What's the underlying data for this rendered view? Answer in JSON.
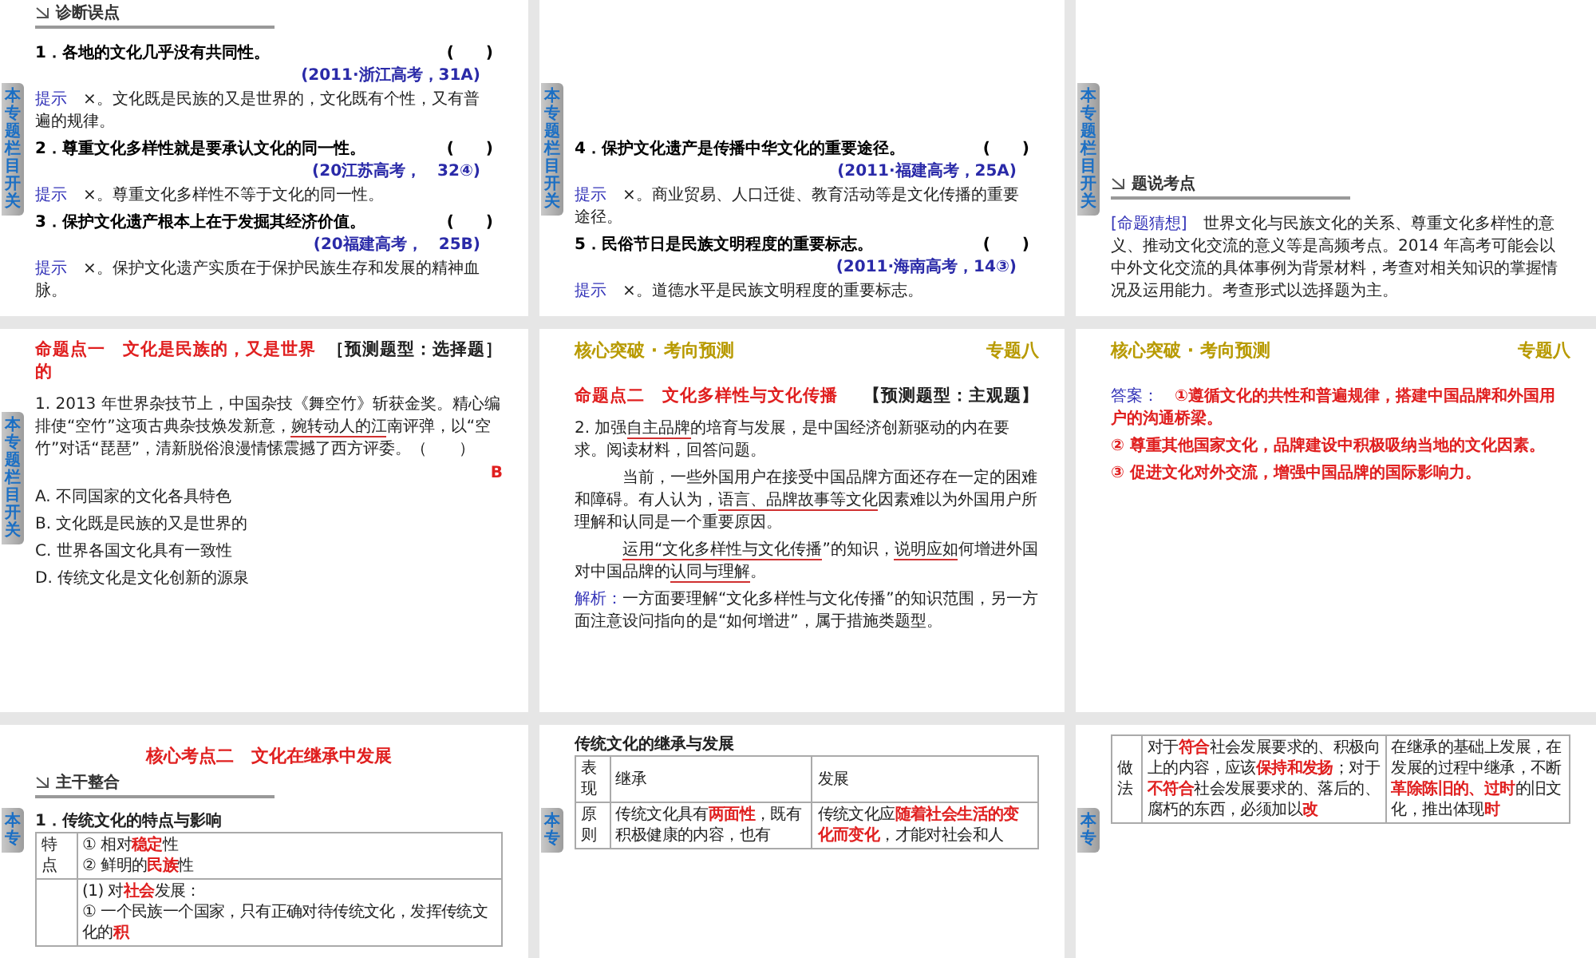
{
  "slides": [
    {
      "tab": "本专题栏目开关",
      "blocks": [
        {
          "kind": "section",
          "text": "诊断误点"
        },
        {
          "kind": "question",
          "text": "1．各地的文化几乎没有共同性。",
          "paren": "(　　)"
        },
        {
          "kind": "source",
          "text": "(2011·浙江高考，31A)"
        },
        {
          "kind": "para",
          "parts": [
            {
              "text": "提示",
              "label": true
            },
            {
              "text": "　×。文化既是民族的又是世界的，文化既有个性，又有普遍的规律。"
            }
          ]
        },
        {
          "kind": "question",
          "text": "2．尊重文化多样性就是要承认文化的同一性。",
          "paren": "(　　)"
        },
        {
          "kind": "source",
          "text": "(20江苏高考，　32④)"
        },
        {
          "kind": "para",
          "parts": [
            {
              "text": "提示",
              "label": true
            },
            {
              "text": "　×。尊重文化多样性不等于文化的同一性。"
            }
          ]
        },
        {
          "kind": "question",
          "text": "3．保护文化遗产根本上在于发掘其经济价值。",
          "paren": "(　　)"
        },
        {
          "kind": "source",
          "text": "(20福建高考，　25B)"
        },
        {
          "kind": "para",
          "parts": [
            {
              "text": "提示",
              "label": true
            },
            {
              "text": "　×。保护文化遗产实质在于保护民族生存和发展的精神血脉。"
            }
          ]
        }
      ]
    },
    {
      "tab": "本专题栏目开关",
      "blocks": [
        {
          "kind": "question",
          "text": "4．保护文化遗产是传播中华文化的重要途径。",
          "paren": "(　　)"
        },
        {
          "kind": "source",
          "text": "(2011·福建高考，25A)"
        },
        {
          "kind": "para",
          "parts": [
            {
              "text": "提示",
              "label": true
            },
            {
              "text": "　×。商业贸易、人口迁徙、教育活动等是文化传播的重要途径。"
            }
          ]
        },
        {
          "kind": "question",
          "text": "5．民俗节日是民族文明程度的重要标志。",
          "paren": "(　　)"
        },
        {
          "kind": "source",
          "text": "(2011·海南高考，14③)"
        },
        {
          "kind": "para",
          "parts": [
            {
              "text": "提示",
              "label": true
            },
            {
              "text": "　×。道德水平是民族文明程度的重要标志。"
            }
          ]
        }
      ]
    },
    {
      "tab": "本专题栏目开关",
      "blocks": [
        {
          "kind": "section",
          "text": "题说考点"
        },
        {
          "kind": "para",
          "parts": [
            {
              "text": "[命题猜想]",
              "label": true
            },
            {
              "text": "　世界文化与民族文化的关系、尊重文化多样性的意义、推动文化交流的意义等是高频考点。2014 年高考可能会以中外文化交流的具体事例为背景材料，考查对相关知识的掌握情况及运用能力。考查形式以选择题为主。"
            }
          ]
        }
      ]
    },
    {
      "tab": "本专题栏目开关",
      "blocks": [
        {
          "kind": "topic",
          "title": "命题点一　文化是民族的，又是世界的",
          "tag": "［预测题型：选择题］"
        },
        {
          "kind": "para",
          "parts": [
            {
              "text": "1. 2013 年世界杂技节上，中国杂技《舞空竹》斩获金奖。精心编排使“空竹”这项古典杂技焕发新意，"
            },
            {
              "text": "婉转动人的江",
              "underlined": true
            },
            {
              "text": "南评弹，以“空竹”对话“琵琶”，清新脱俗浪漫情愫震撼了西方评委。（　　）"
            }
          ]
        },
        {
          "kind": "answer-mark",
          "text": "B"
        },
        {
          "kind": "option",
          "text": "A. 不同国家的文化各具特色"
        },
        {
          "kind": "option",
          "text": "B. 文化既是民族的又是世界的"
        },
        {
          "kind": "option",
          "text": "C. 世界各国文化具有一致性"
        },
        {
          "kind": "option",
          "text": "D. 传统文化是文化创新的源泉"
        }
      ]
    },
    {
      "header": {
        "title": "核心突破 · 考向预测",
        "chapter": "专题八"
      },
      "blocks": [
        {
          "kind": "topic",
          "title": "命题点二　文化多样性与文化传播",
          "tag": "【预测题型：主观题】"
        },
        {
          "kind": "para",
          "parts": [
            {
              "text": "2. 加强"
            },
            {
              "text": "自主品牌",
              "underlined": true
            },
            {
              "text": "的培育与发展，是中国经济创新驱动的内在要求。阅读材料，回答问题。"
            }
          ]
        },
        {
          "kind": "para",
          "indent": true,
          "parts": [
            {
              "text": "当前，一些外国用户在接受中国品牌方面还存在一定的困难和障碍。有人认为，"
            },
            {
              "text": "语言、品牌故事等文化",
              "underlined": true
            },
            {
              "text": "因素难以为外国用户所理解和认同是一个重要原因。"
            }
          ]
        },
        {
          "kind": "para",
          "indent": true,
          "parts": [
            {
              "text": "运用“文化多样性与文化传播",
              "underlined": true
            },
            {
              "text": "”的知识，"
            },
            {
              "text": "说明应如",
              "underlined": true
            },
            {
              "text": "何增进外国对中国品牌的"
            },
            {
              "text": "认同与理解",
              "underlined": true
            },
            {
              "text": "。"
            }
          ]
        },
        {
          "kind": "para",
          "parts": [
            {
              "text": "解析：",
              "label": true
            },
            {
              "text": "一方面要理解“文化多样性与文化传播”的知识范围，另一方面注意设问指向的是“如何增进”，属于措施类题型。"
            }
          ]
        }
      ]
    },
    {
      "header": {
        "title": "核心突破 · 考向预测",
        "chapter": "专题八"
      },
      "blocks": [
        {
          "kind": "para",
          "parts": [
            {
              "text": "答案：",
              "label": true
            },
            {
              "text": "　①遵循文化的共性和普遍规律，搭建中国品牌和外国用户的沟通桥梁。",
              "emphasis": true
            }
          ]
        },
        {
          "kind": "para",
          "parts": [
            {
              "text": "② 尊重其他国家文化，品牌建设中积极吸纳当地的文化因素。",
              "emphasis": true
            }
          ]
        },
        {
          "kind": "para",
          "parts": [
            {
              "text": "③ 促进文化对外交流，增强中国品牌的国际影响力。",
              "emphasis": true
            }
          ]
        }
      ]
    },
    {
      "tab": "本专",
      "blocks": [
        {
          "kind": "heading",
          "text": "核心考点二　文化在继承中发展"
        },
        {
          "kind": "section",
          "text": "主干整合"
        },
        {
          "kind": "table-title",
          "text": "1．传统文化的特点与影响"
        },
        {
          "kind": "table",
          "rows": [
            {
              "cells": [
                {
                  "parts": [
                    {
                      "text": "特点"
                    }
                  ]
                },
                {
                  "parts": [
                    {
                      "text": "① 相对"
                    },
                    {
                      "text": "稳定",
                      "emphasis": true
                    },
                    {
                      "text": "性\n② 鲜明的"
                    },
                    {
                      "text": "民族",
                      "emphasis": true
                    },
                    {
                      "text": "性"
                    }
                  ]
                }
              ]
            },
            {
              "cells": [
                {},
                {
                  "parts": [
                    {
                      "text": "(1) 对"
                    },
                    {
                      "text": "社会",
                      "emphasis": true
                    },
                    {
                      "text": "发展：\n① 一个民族一个国家，只有正确对待传统文化，发挥传统文化的"
                    },
                    {
                      "text": "积",
                      "emphasis": true
                    }
                  ]
                }
              ]
            }
          ]
        }
      ]
    },
    {
      "tab": "本专",
      "blocks": [
        {
          "kind": "table-title",
          "text": "传统文化的继承与发展"
        },
        {
          "kind": "table",
          "rows": [
            {
              "cells": [
                {
                  "parts": [
                    {
                      "text": "表现"
                    }
                  ]
                },
                {
                  "parts": [
                    {
                      "text": "继承"
                    }
                  ]
                },
                {
                  "parts": [
                    {
                      "text": "发展"
                    }
                  ]
                }
              ]
            },
            {
              "cells": [
                {
                  "parts": [
                    {
                      "text": "原则"
                    }
                  ]
                },
                {
                  "parts": [
                    {
                      "text": "传统文化具有"
                    },
                    {
                      "text": "两面性",
                      "emphasis": true
                    },
                    {
                      "text": "，既有积极健康的内容，也有"
                    }
                  ]
                },
                {
                  "parts": [
                    {
                      "text": "传统文化应"
                    },
                    {
                      "text": "随着社会生活的变化而变化",
                      "emphasis": true
                    },
                    {
                      "text": "，才能对社会和人"
                    }
                  ]
                }
              ]
            }
          ]
        }
      ]
    },
    {
      "tab": "本专",
      "blocks": [
        {
          "kind": "table",
          "rows": [
            {
              "cells": [
                {
                  "parts": [
                    {
                      "text": "做法"
                    }
                  ]
                },
                {
                  "parts": [
                    {
                      "text": "对于"
                    },
                    {
                      "text": "符合",
                      "emphasis": true
                    },
                    {
                      "text": "社会发展要求的、积极向上的内容，应该"
                    },
                    {
                      "text": "保持和发扬",
                      "emphasis": true
                    },
                    {
                      "text": "；对于"
                    },
                    {
                      "text": "不符合",
                      "emphasis": true
                    },
                    {
                      "text": "社会发展要求的、落后的、腐朽的东西，必须加以"
                    },
                    {
                      "text": "改",
                      "emphasis": true
                    }
                  ]
                },
                {
                  "parts": [
                    {
                      "text": "在继承的基础上发展，在发展的过程中继承，不断"
                    },
                    {
                      "text": "革除陈旧的、过时",
                      "emphasis": true
                    },
                    {
                      "text": "的旧文化，推出体现"
                    },
                    {
                      "text": "时",
                      "emphasis": true
                    }
                  ]
                }
              ]
            }
          ]
        }
      ]
    }
  ]
}
